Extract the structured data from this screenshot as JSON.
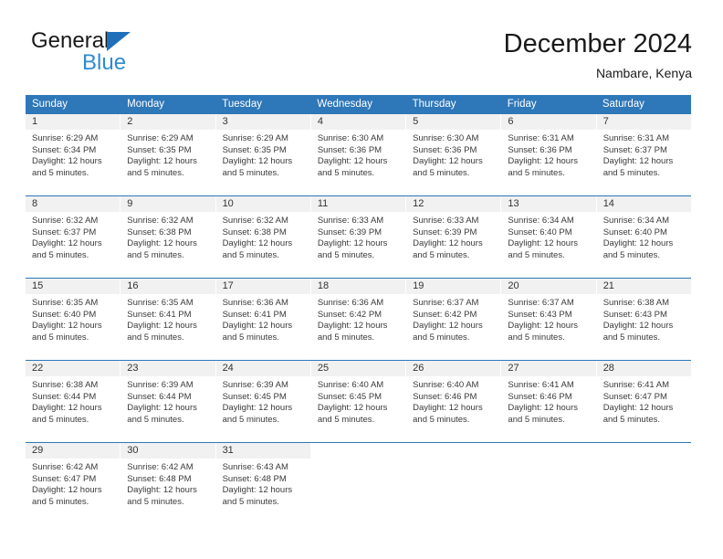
{
  "brand": {
    "name_part1": "General",
    "name_part2": "Blue",
    "triangle_color": "#1f6fba",
    "blue_color": "#2e8bd0"
  },
  "header": {
    "title": "December 2024",
    "subtitle": "Nambare, Kenya"
  },
  "theme": {
    "header_blue": "#2e77b8",
    "daynum_gray": "#f1f1f1"
  },
  "weekdays": [
    "Sunday",
    "Monday",
    "Tuesday",
    "Wednesday",
    "Thursday",
    "Friday",
    "Saturday"
  ],
  "labels": {
    "sunrise_prefix": "Sunrise:",
    "sunset_prefix": "Sunset:",
    "daylight_prefix": "Daylight:"
  },
  "weeks": [
    [
      {
        "day": "1",
        "sunrise": "Sunrise: 6:29 AM",
        "sunset": "Sunset: 6:34 PM",
        "daylight": "Daylight: 12 hours and 5 minutes."
      },
      {
        "day": "2",
        "sunrise": "Sunrise: 6:29 AM",
        "sunset": "Sunset: 6:35 PM",
        "daylight": "Daylight: 12 hours and 5 minutes."
      },
      {
        "day": "3",
        "sunrise": "Sunrise: 6:29 AM",
        "sunset": "Sunset: 6:35 PM",
        "daylight": "Daylight: 12 hours and 5 minutes."
      },
      {
        "day": "4",
        "sunrise": "Sunrise: 6:30 AM",
        "sunset": "Sunset: 6:36 PM",
        "daylight": "Daylight: 12 hours and 5 minutes."
      },
      {
        "day": "5",
        "sunrise": "Sunrise: 6:30 AM",
        "sunset": "Sunset: 6:36 PM",
        "daylight": "Daylight: 12 hours and 5 minutes."
      },
      {
        "day": "6",
        "sunrise": "Sunrise: 6:31 AM",
        "sunset": "Sunset: 6:36 PM",
        "daylight": "Daylight: 12 hours and 5 minutes."
      },
      {
        "day": "7",
        "sunrise": "Sunrise: 6:31 AM",
        "sunset": "Sunset: 6:37 PM",
        "daylight": "Daylight: 12 hours and 5 minutes."
      }
    ],
    [
      {
        "day": "8",
        "sunrise": "Sunrise: 6:32 AM",
        "sunset": "Sunset: 6:37 PM",
        "daylight": "Daylight: 12 hours and 5 minutes."
      },
      {
        "day": "9",
        "sunrise": "Sunrise: 6:32 AM",
        "sunset": "Sunset: 6:38 PM",
        "daylight": "Daylight: 12 hours and 5 minutes."
      },
      {
        "day": "10",
        "sunrise": "Sunrise: 6:32 AM",
        "sunset": "Sunset: 6:38 PM",
        "daylight": "Daylight: 12 hours and 5 minutes."
      },
      {
        "day": "11",
        "sunrise": "Sunrise: 6:33 AM",
        "sunset": "Sunset: 6:39 PM",
        "daylight": "Daylight: 12 hours and 5 minutes."
      },
      {
        "day": "12",
        "sunrise": "Sunrise: 6:33 AM",
        "sunset": "Sunset: 6:39 PM",
        "daylight": "Daylight: 12 hours and 5 minutes."
      },
      {
        "day": "13",
        "sunrise": "Sunrise: 6:34 AM",
        "sunset": "Sunset: 6:40 PM",
        "daylight": "Daylight: 12 hours and 5 minutes."
      },
      {
        "day": "14",
        "sunrise": "Sunrise: 6:34 AM",
        "sunset": "Sunset: 6:40 PM",
        "daylight": "Daylight: 12 hours and 5 minutes."
      }
    ],
    [
      {
        "day": "15",
        "sunrise": "Sunrise: 6:35 AM",
        "sunset": "Sunset: 6:40 PM",
        "daylight": "Daylight: 12 hours and 5 minutes."
      },
      {
        "day": "16",
        "sunrise": "Sunrise: 6:35 AM",
        "sunset": "Sunset: 6:41 PM",
        "daylight": "Daylight: 12 hours and 5 minutes."
      },
      {
        "day": "17",
        "sunrise": "Sunrise: 6:36 AM",
        "sunset": "Sunset: 6:41 PM",
        "daylight": "Daylight: 12 hours and 5 minutes."
      },
      {
        "day": "18",
        "sunrise": "Sunrise: 6:36 AM",
        "sunset": "Sunset: 6:42 PM",
        "daylight": "Daylight: 12 hours and 5 minutes."
      },
      {
        "day": "19",
        "sunrise": "Sunrise: 6:37 AM",
        "sunset": "Sunset: 6:42 PM",
        "daylight": "Daylight: 12 hours and 5 minutes."
      },
      {
        "day": "20",
        "sunrise": "Sunrise: 6:37 AM",
        "sunset": "Sunset: 6:43 PM",
        "daylight": "Daylight: 12 hours and 5 minutes."
      },
      {
        "day": "21",
        "sunrise": "Sunrise: 6:38 AM",
        "sunset": "Sunset: 6:43 PM",
        "daylight": "Daylight: 12 hours and 5 minutes."
      }
    ],
    [
      {
        "day": "22",
        "sunrise": "Sunrise: 6:38 AM",
        "sunset": "Sunset: 6:44 PM",
        "daylight": "Daylight: 12 hours and 5 minutes."
      },
      {
        "day": "23",
        "sunrise": "Sunrise: 6:39 AM",
        "sunset": "Sunset: 6:44 PM",
        "daylight": "Daylight: 12 hours and 5 minutes."
      },
      {
        "day": "24",
        "sunrise": "Sunrise: 6:39 AM",
        "sunset": "Sunset: 6:45 PM",
        "daylight": "Daylight: 12 hours and 5 minutes."
      },
      {
        "day": "25",
        "sunrise": "Sunrise: 6:40 AM",
        "sunset": "Sunset: 6:45 PM",
        "daylight": "Daylight: 12 hours and 5 minutes."
      },
      {
        "day": "26",
        "sunrise": "Sunrise: 6:40 AM",
        "sunset": "Sunset: 6:46 PM",
        "daylight": "Daylight: 12 hours and 5 minutes."
      },
      {
        "day": "27",
        "sunrise": "Sunrise: 6:41 AM",
        "sunset": "Sunset: 6:46 PM",
        "daylight": "Daylight: 12 hours and 5 minutes."
      },
      {
        "day": "28",
        "sunrise": "Sunrise: 6:41 AM",
        "sunset": "Sunset: 6:47 PM",
        "daylight": "Daylight: 12 hours and 5 minutes."
      }
    ],
    [
      {
        "day": "29",
        "sunrise": "Sunrise: 6:42 AM",
        "sunset": "Sunset: 6:47 PM",
        "daylight": "Daylight: 12 hours and 5 minutes."
      },
      {
        "day": "30",
        "sunrise": "Sunrise: 6:42 AM",
        "sunset": "Sunset: 6:48 PM",
        "daylight": "Daylight: 12 hours and 5 minutes."
      },
      {
        "day": "31",
        "sunrise": "Sunrise: 6:43 AM",
        "sunset": "Sunset: 6:48 PM",
        "daylight": "Daylight: 12 hours and 5 minutes."
      },
      {
        "day": "",
        "sunrise": "",
        "sunset": "",
        "daylight": ""
      },
      {
        "day": "",
        "sunrise": "",
        "sunset": "",
        "daylight": ""
      },
      {
        "day": "",
        "sunrise": "",
        "sunset": "",
        "daylight": ""
      },
      {
        "day": "",
        "sunrise": "",
        "sunset": "",
        "daylight": ""
      }
    ]
  ]
}
